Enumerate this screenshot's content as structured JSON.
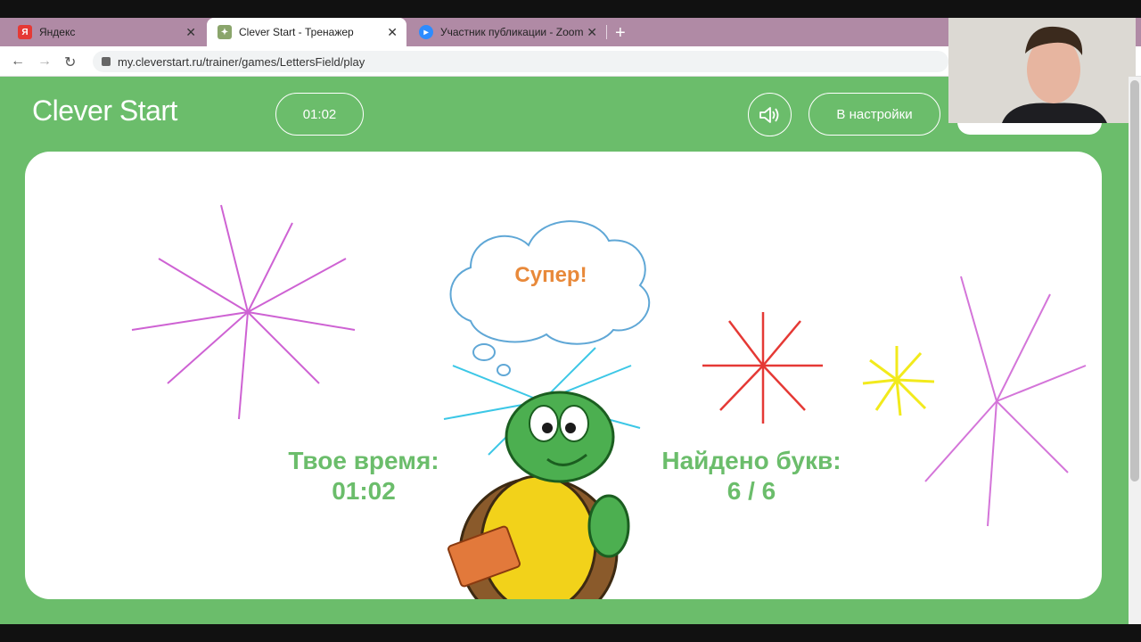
{
  "browser": {
    "tabs": [
      {
        "label": "Яндекс",
        "icon": "yandex-icon",
        "active": false
      },
      {
        "label": "Clever Start - Тренажер",
        "icon": "turtle-icon",
        "active": true
      },
      {
        "label": "Участник публикации - Zoom",
        "icon": "zoom-icon",
        "active": false
      }
    ],
    "new_tab": "+",
    "url": "my.cleverstart.ru/trainer/games/LettersField/play"
  },
  "header": {
    "logo": "Clever Start",
    "timer": "01:02",
    "settings_label": "В настройки"
  },
  "result": {
    "bubble_text": "Супер!",
    "time_label": "Твое время:",
    "time_value": "01:02",
    "letters_label": "Найдено букв:",
    "letters_value": "6 / 6"
  },
  "colors": {
    "page_green": "#6bbd6b",
    "bubble_orange": "#e8893a",
    "tab_bar": "#b08aa5"
  }
}
